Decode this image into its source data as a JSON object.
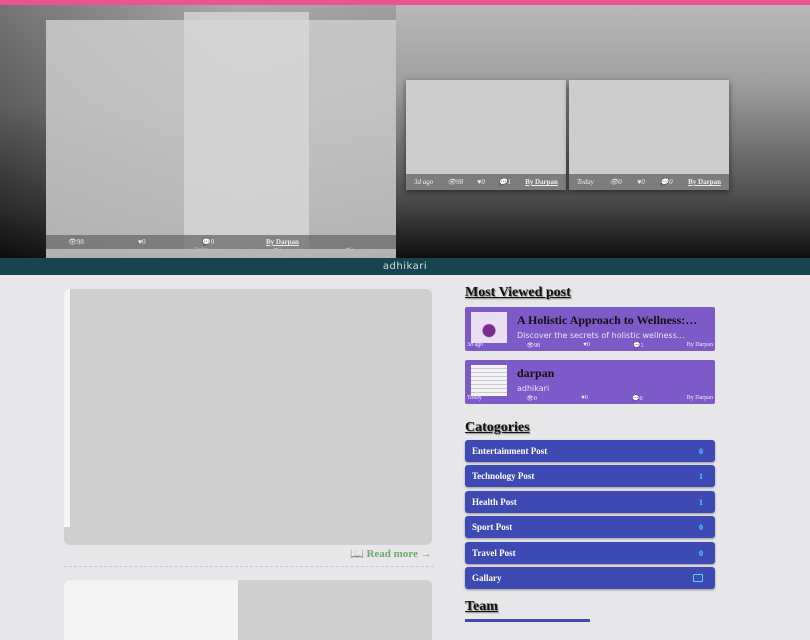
{
  "hero": {
    "caption": "adhikari",
    "cards": [
      {
        "date": "3d ago",
        "views": "98",
        "likes": "0",
        "comments": "1",
        "author": "By Darpan"
      },
      {
        "date": "Today",
        "views": "0",
        "likes": "0",
        "comments": "0",
        "author": "By Darpan"
      }
    ],
    "big_card": {
      "views": "98",
      "likes": "0",
      "comments": "0",
      "author": "By Darpan"
    },
    "big_card2": {
      "date": "Today",
      "views": "0",
      "likes": "0"
    }
  },
  "main": {
    "read_more_label": "Read more"
  },
  "sidebar": {
    "most_viewed_title": "Most Viewed post",
    "most_viewed": [
      {
        "title": "A Holistic Approach to Wellness:…",
        "desc": "Discover the secrets of holistic wellness…",
        "date": "3d ago",
        "views": "98",
        "likes": "0",
        "comments": "1",
        "author": "By Darpan"
      },
      {
        "title": "darpan",
        "desc": "adhikari",
        "date": "Today",
        "views": "0",
        "likes": "0",
        "comments": "0",
        "author": "By Darpan"
      }
    ],
    "categories_title": "Catogories",
    "categories": [
      {
        "label": "Entertainment Post",
        "count": "0"
      },
      {
        "label": "Technology Post",
        "count": "1"
      },
      {
        "label": "Health Post",
        "count": "1"
      },
      {
        "label": "Sport Post",
        "count": "0"
      },
      {
        "label": "Travel Post",
        "count": "0"
      },
      {
        "label": "Gallary",
        "count": ""
      }
    ],
    "team_title": "Team"
  },
  "colors": {
    "accent_pink": "#e8558f",
    "category_bg": "#3d4ab4",
    "most_viewed_bg": "#7e5ac8",
    "caption_bar": "#17454f",
    "read_more": "#6fa86f"
  }
}
